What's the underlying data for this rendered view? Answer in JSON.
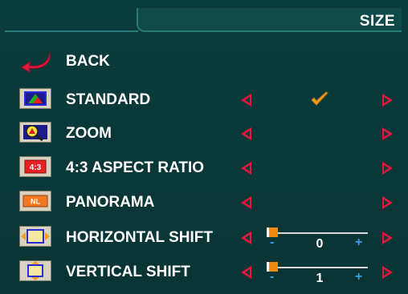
{
  "header": {
    "title": "SIZE"
  },
  "menu": {
    "back": {
      "label": "BACK",
      "icon": "back-arrow-icon"
    },
    "items": [
      {
        "label": "STANDARD",
        "icon": "standard-icon",
        "selected": true
      },
      {
        "label": "ZOOM",
        "icon": "zoom-icon",
        "selected": false
      },
      {
        "label": "4:3 ASPECT RATIO",
        "icon": "aspect-ratio-icon",
        "icon_text": "4:3",
        "selected": false
      },
      {
        "label": "PANORAMA",
        "icon": "panorama-icon",
        "icon_text": "NL",
        "selected": false
      },
      {
        "label": "HORIZONTAL SHIFT",
        "icon": "horizontal-shift-icon",
        "slider": {
          "value": "0",
          "minus": "-",
          "plus": "+"
        }
      },
      {
        "label": "VERTICAL SHIFT",
        "icon": "vertical-shift-icon",
        "slider": {
          "value": "1",
          "minus": "-",
          "plus": "+"
        }
      }
    ]
  },
  "colors": {
    "background": "#0a3a3a",
    "arrow": "#e8163d",
    "check": "#f0a020",
    "slider_thumb": "#f08a10",
    "slider_signs": "#3aa0e8"
  }
}
